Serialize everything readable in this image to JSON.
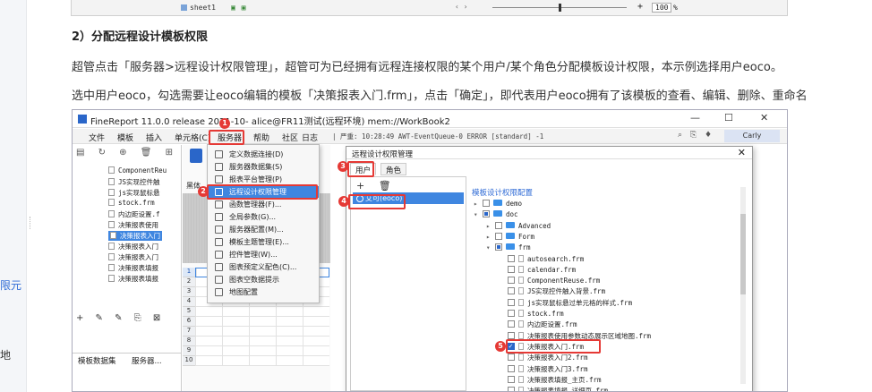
{
  "sidebar_fragments": {
    "item1": "限元",
    "item2": "地"
  },
  "prev_screenshot": {
    "sheet_tab": "sheet1",
    "zoom": "100",
    "zoom_unit": "%",
    "plus": "+"
  },
  "heading": "2）分配远程设计模板权限",
  "para1": "超管点击「服务器>远程设计权限管理」，超管可为已经拥有远程连接权限的某个用户/某个角色分配模板设计权限，本示例选择用户eoco。",
  "para2": "选中用户eoco，勾选需要让eoco编辑的模板「决策报表入门.frm」，点击「确定」，即代表用户eoco拥有了该模板的查看、编辑、删除、重命名",
  "window": {
    "title": "FineReport 11.0.0 release 2021-10-    alice@FR11测试(远程环境)     mem://WorkBook2",
    "min": "—",
    "max": "☐",
    "close": "✕",
    "menu": [
      "文件",
      "模板",
      "插入",
      "单元格(C)",
      "服务器",
      "帮助",
      "社区",
      "日志"
    ],
    "console": "| 严重: 10:28:49 AWT-EventQueue-0 ERROR [standard] -1",
    "user": "Carly",
    "left_tree": [
      "ComponentReu",
      "JS实现控件触",
      "js实现鼠标悬",
      "stock.frm",
      "内边距设置.f",
      "决策报表使用",
      "决策报表入门",
      "决策报表入门",
      "决策报表入门",
      "决策报表填报",
      "决策报表填报"
    ],
    "left_tabs": [
      "模板数据集",
      "服务器..."
    ],
    "font_label": "黑体",
    "rows": [
      "1",
      "2",
      "3",
      "4",
      "5",
      "6",
      "7",
      "8",
      "9",
      "10"
    ],
    "service_menu": [
      "定义数据连接(D)",
      "服务器数据集(S)",
      "报表平台管理(P)",
      "远程设计权限管理",
      "函数管理器(F)...",
      "全局参数(G)...",
      "服务器配置(M)...",
      "模板主题管理(E)...",
      "控件管理(W)...",
      "图表预定义配色(C)...",
      "图表空数据提示",
      "地图配置"
    ]
  },
  "dialog": {
    "title": "远程设计权限管理",
    "close": "✕",
    "tabs": [
      "用户",
      "角色"
    ],
    "tools": "+ 🗑",
    "user": "艾可(eoco)",
    "section": "模板设计权限配置",
    "tree": [
      {
        "label": "demo",
        "type": "folder",
        "level": 0,
        "arrow": "▸",
        "check": "none"
      },
      {
        "label": "doc",
        "type": "folder",
        "level": 0,
        "arrow": "▾",
        "check": "part"
      },
      {
        "label": "Advanced",
        "type": "folder",
        "level": 1,
        "arrow": "▸",
        "check": "none"
      },
      {
        "label": "Form",
        "type": "folder",
        "level": 1,
        "arrow": "▸",
        "check": "none"
      },
      {
        "label": "frm",
        "type": "folder",
        "level": 1,
        "arrow": "▾",
        "check": "part"
      },
      {
        "label": "autosearch.frm",
        "type": "file",
        "level": 2,
        "check": "none"
      },
      {
        "label": "calendar.frm",
        "type": "file",
        "level": 2,
        "check": "none"
      },
      {
        "label": "ComponentReuse.frm",
        "type": "file",
        "level": 2,
        "check": "none"
      },
      {
        "label": "JS实现控件触入背景.frm",
        "type": "file",
        "level": 2,
        "check": "none"
      },
      {
        "label": "js实现鼠标悬过单元格的样式.frm",
        "type": "file",
        "level": 2,
        "check": "none"
      },
      {
        "label": "stock.frm",
        "type": "file",
        "level": 2,
        "check": "none"
      },
      {
        "label": "内边距设置.frm",
        "type": "file",
        "level": 2,
        "check": "none"
      },
      {
        "label": "决策报表使用参数动态展示区域地图.frm",
        "type": "file",
        "level": 2,
        "check": "none"
      },
      {
        "label": "决策报表入门.frm",
        "type": "file",
        "level": 2,
        "check": "on"
      },
      {
        "label": "决策报表入门2.frm",
        "type": "file",
        "level": 2,
        "check": "none"
      },
      {
        "label": "决策报表入门3.frm",
        "type": "file",
        "level": 2,
        "check": "none"
      },
      {
        "label": "决策报表填报_主页.frm",
        "type": "file",
        "level": 2,
        "check": "none"
      },
      {
        "label": "决策报表填报_详细页.frm",
        "type": "file",
        "level": 2,
        "check": "none"
      }
    ]
  },
  "callouts": [
    "1",
    "2",
    "3",
    "4",
    "5"
  ],
  "colors": {
    "accent": "#3f86e0",
    "callout": "#e53935",
    "brand": "#2a66c9"
  }
}
